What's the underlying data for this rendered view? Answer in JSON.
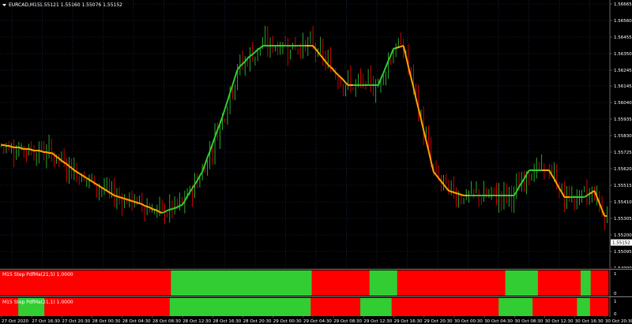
{
  "header": {
    "symbol_label": "EURCAD,M15",
    "ohlc": "1.55121 1.55160 1.55076 1.55152"
  },
  "price_axis": {
    "ticks": [
      "1.56665",
      "1.56560",
      "1.56455",
      "1.56350",
      "1.56245",
      "1.56145",
      "1.56040",
      "1.55935",
      "1.55830",
      "1.55725",
      "1.55620",
      "1.55515",
      "1.55410",
      "1.55305",
      "1.55200",
      "1.55095",
      "1.54990"
    ],
    "current_price": "1.55152"
  },
  "time_axis": {
    "ticks": [
      "27 Oct 2020",
      "27 Oct 16:30",
      "27 Oct 20:30",
      "28 Oct 00:30",
      "28 Oct 04:30",
      "28 Oct 08:30",
      "28 Oct 12:30",
      "28 Oct 16:30",
      "28 Oct 20:30",
      "29 Oct 00:30",
      "29 Oct 04:30",
      "29 Oct 08:30",
      "29 Oct 12:30",
      "29 Oct 16:30",
      "29 Oct 20:30",
      "30 Oct 00:30",
      "30 Oct 04:30",
      "30 Oct 08:30",
      "30 Oct 12:30",
      "30 Oct 16:30",
      "30 Oct 20:30"
    ]
  },
  "indicators": [
    {
      "label": "M15 Step PdfMa(21,5) 1.0000",
      "axis_top": "1",
      "axis_bottom": "0",
      "segments": [
        {
          "state": "down",
          "bars": 68
        },
        {
          "state": "up",
          "bars": 56
        },
        {
          "state": "down",
          "bars": 23
        },
        {
          "state": "up",
          "bars": 11
        },
        {
          "state": "down",
          "bars": 43
        },
        {
          "state": "up",
          "bars": 13
        },
        {
          "state": "down",
          "bars": 17
        },
        {
          "state": "up",
          "bars": 4
        },
        {
          "state": "down",
          "bars": 7
        }
      ]
    },
    {
      "label": "M15 Step PdfMa(21,1) 1.0000",
      "axis_top": "1",
      "axis_bottom": "0",
      "segments": [
        {
          "state": "down",
          "bars": 7
        },
        {
          "state": "up",
          "bars": 10
        },
        {
          "state": "down",
          "bars": 48
        },
        {
          "state": "up",
          "bars": 54
        },
        {
          "state": "down",
          "bars": 19
        },
        {
          "state": "up",
          "bars": 12
        },
        {
          "state": "down",
          "bars": 41
        },
        {
          "state": "up",
          "bars": 13
        },
        {
          "state": "down",
          "bars": 17
        },
        {
          "state": "up",
          "bars": 5
        },
        {
          "state": "down",
          "bars": 7
        }
      ]
    }
  ],
  "chart_data": {
    "type": "line",
    "price_range": [
      1.5499,
      1.5669
    ],
    "bars": 242,
    "step_line": {
      "anchors": [
        [
          0,
          1.5577
        ],
        [
          20,
          1.5572
        ],
        [
          30,
          1.556
        ],
        [
          45,
          1.5545
        ],
        [
          55,
          1.554
        ],
        [
          64,
          1.5534
        ],
        [
          72,
          1.5539
        ],
        [
          80,
          1.556
        ],
        [
          88,
          1.5595
        ],
        [
          94,
          1.5625
        ],
        [
          98,
          1.5632
        ],
        [
          104,
          1.564
        ],
        [
          124,
          1.564
        ],
        [
          130,
          1.5628
        ],
        [
          138,
          1.5615
        ],
        [
          150,
          1.5615
        ],
        [
          156,
          1.5638
        ],
        [
          160,
          1.564
        ],
        [
          166,
          1.56
        ],
        [
          172,
          1.556
        ],
        [
          178,
          1.5548
        ],
        [
          184,
          1.5545
        ],
        [
          204,
          1.5545
        ],
        [
          210,
          1.5561
        ],
        [
          218,
          1.5561
        ],
        [
          224,
          1.5544
        ],
        [
          232,
          1.5544
        ],
        [
          236,
          1.5548
        ],
        [
          240,
          1.5532
        ]
      ]
    },
    "colors": {
      "up": "#32cd32",
      "down": "#ff0000",
      "step_up": "#32cd32",
      "step_down": "#ffa500",
      "grid": "#1e3a5f"
    }
  }
}
